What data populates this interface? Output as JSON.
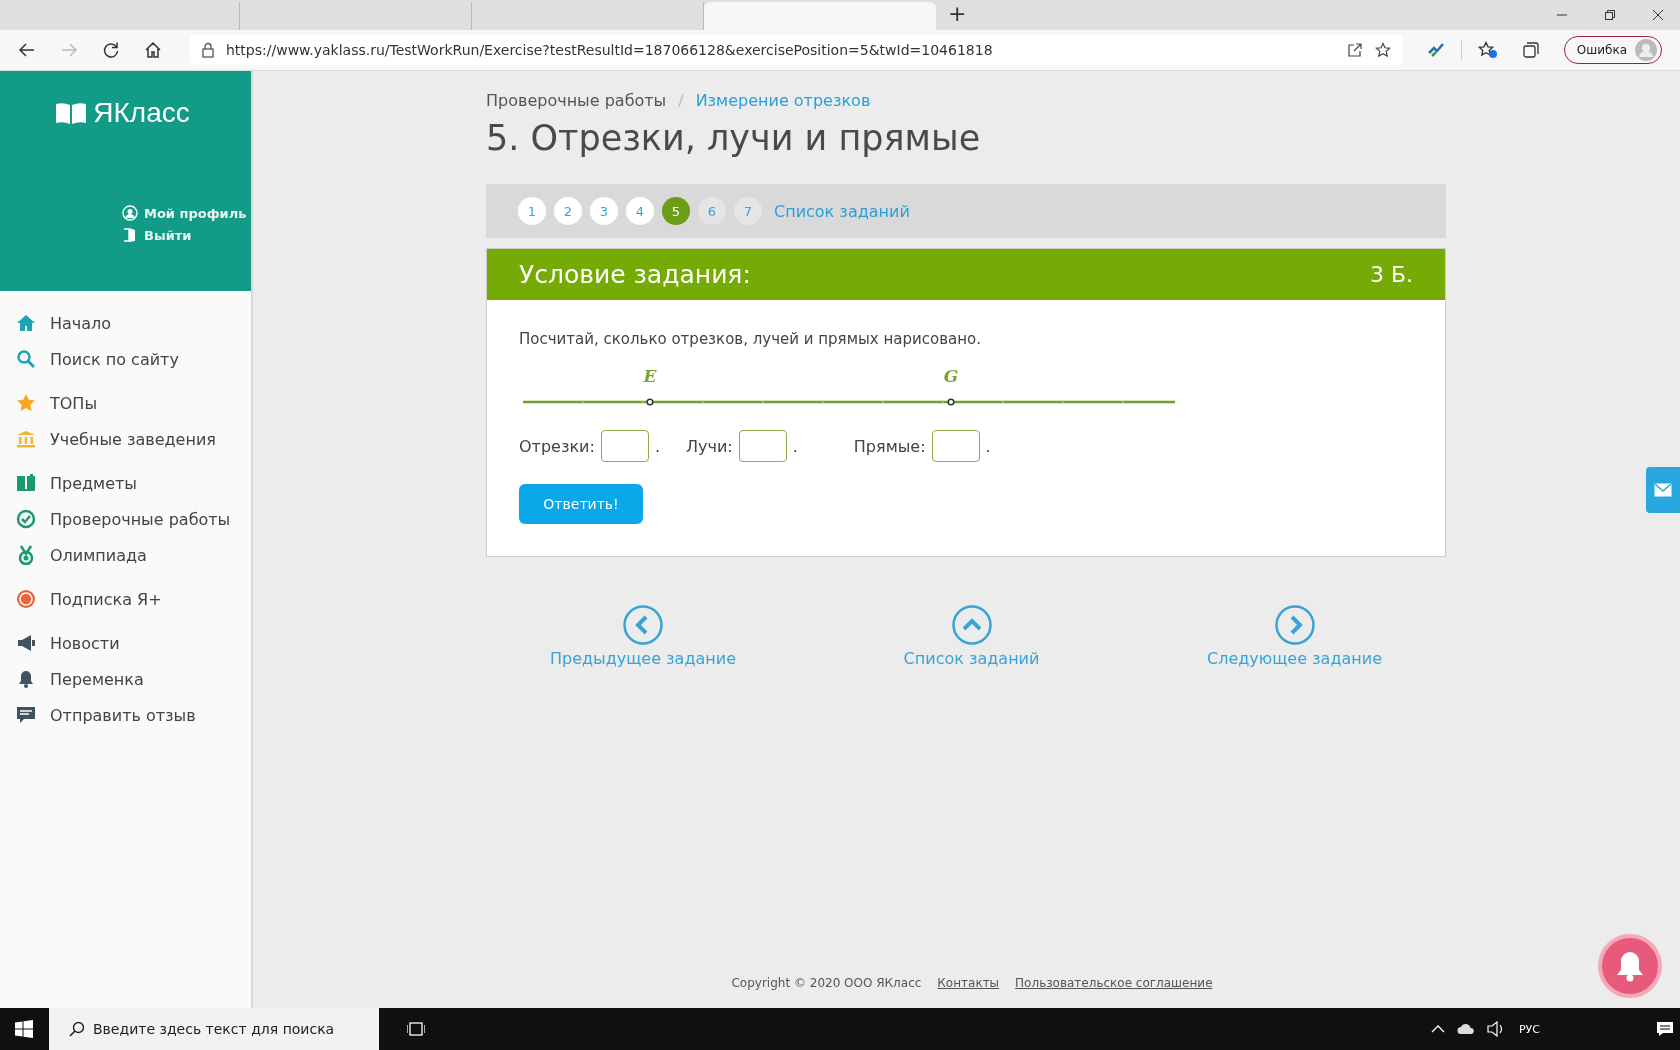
{
  "browser": {
    "tabs": [
      {
        "selected": false
      },
      {
        "selected": false
      },
      {
        "selected": false
      },
      {
        "selected": true
      }
    ],
    "new_tab": "+",
    "url": "https://www.yaklass.ru/TestWorkRun/Exercise?testResultId=187066128&exercisePosition=5&twId=10461818",
    "profile": "Ошибка"
  },
  "sidebar": {
    "logo": "ЯКласс",
    "profile_links": [
      "Мой профиль",
      "Выйти"
    ],
    "groups": [
      [
        {
          "label": "Начало"
        },
        {
          "label": "Поиск по сайту"
        }
      ],
      [
        {
          "label": "ТОПы"
        },
        {
          "label": "Учебные заведения"
        }
      ],
      [
        {
          "label": "Предметы"
        },
        {
          "label": "Проверочные работы"
        },
        {
          "label": "Олимпиада"
        }
      ],
      [
        {
          "label": "Подписка Я+"
        }
      ],
      [
        {
          "label": "Новости"
        },
        {
          "label": "Переменка"
        },
        {
          "label": "Отправить отзыв"
        }
      ]
    ]
  },
  "breadcrumb": [
    {
      "label": "Проверочные работы",
      "link": false
    },
    {
      "label": "Измерение отрезков",
      "link": true
    }
  ],
  "breadcrumb_separator": "/",
  "title": "5. Отрезки, лучи и прямые",
  "pager": {
    "items": [
      {
        "label": "1",
        "selected": false,
        "visited": true
      },
      {
        "label": "2",
        "selected": false,
        "visited": true
      },
      {
        "label": "3",
        "selected": false,
        "visited": true
      },
      {
        "label": "4",
        "selected": false,
        "visited": true
      },
      {
        "label": "5",
        "selected": true,
        "visited": true
      },
      {
        "label": "6",
        "selected": false,
        "visited": false
      },
      {
        "label": "7",
        "selected": false,
        "visited": false
      }
    ],
    "list_link": "Список заданий"
  },
  "task": {
    "heading": "Условие задания:",
    "points": "3 Б.",
    "text": "Посчитай, сколько отрезков, лучей и прямых нарисовано.",
    "figure": {
      "points": [
        "E",
        "G"
      ]
    },
    "answers": [
      {
        "label": "Отрезки:",
        "suffix": "."
      },
      {
        "label": "Лучи:",
        "suffix": "."
      },
      {
        "label": "Прямые:",
        "suffix": "."
      }
    ],
    "submit": "Ответить!"
  },
  "navigation": [
    {
      "kind": "prev",
      "label": "Предыдущее задание"
    },
    {
      "kind": "up",
      "label": "Список заданий"
    },
    {
      "kind": "next",
      "label": "Следующее задание"
    }
  ],
  "footer": {
    "copyright": "Copyright © 2020 ООО ЯКласс",
    "links": [
      "Контакты",
      "Пользовательское соглашение"
    ]
  },
  "taskbar": {
    "search": {
      "placeholder": "Введите здесь текст для поиска"
    },
    "language": "РУС"
  }
}
